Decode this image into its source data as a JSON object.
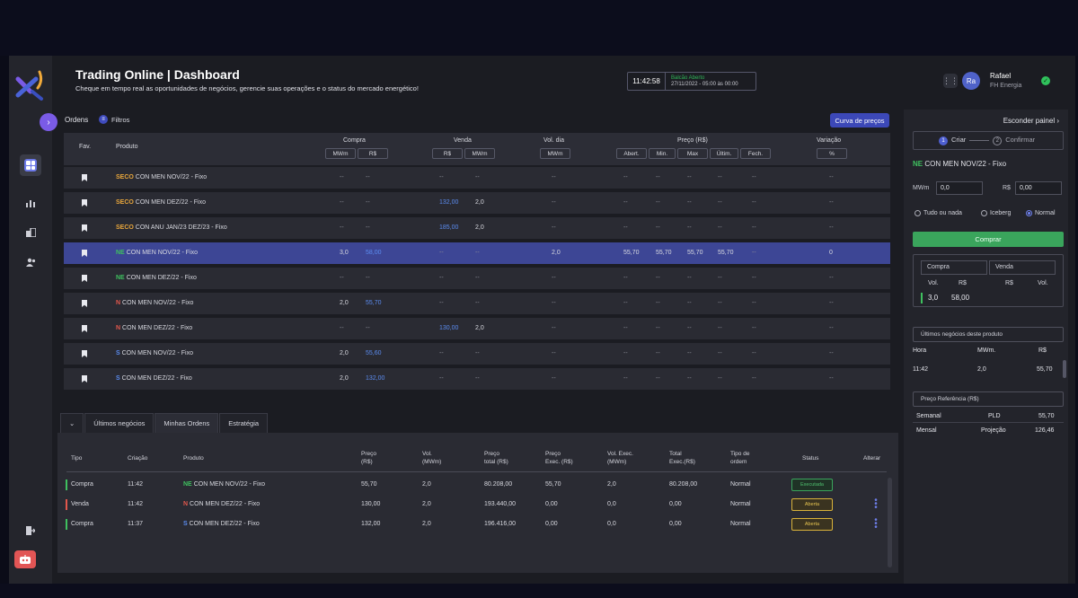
{
  "header": {
    "title": "Trading Online | Dashboard",
    "subtitle": "Cheque em tempo real as oportunidades de negócios, gerencie suas operações e o status do mercado energético!",
    "clock": "11:42:58",
    "session_label": "Balcão Aberto",
    "session_date": "27/11/2022 - 05:00 às 00:00",
    "user_initials": "Ra",
    "user_name": "Rafael",
    "user_company": "FH Energia",
    "status_color": "#30c25c"
  },
  "sidebar": {
    "icons": [
      "dashboard-icon",
      "bar-chart-icon",
      "building-icon",
      "users-icon"
    ],
    "logout_icon": "logout-icon",
    "assistant_icon": "bot-icon"
  },
  "orders": {
    "section_label": "Ordens",
    "filter_label": "Filtros",
    "curve_button": "Curva de preços",
    "headers": {
      "fav": "Fav.",
      "produto": "Produto",
      "compra": "Compra",
      "venda": "Venda",
      "vol_dia": "Vol. dia",
      "preco": "Preço (R$)",
      "variacao": "Variação",
      "compra_mwm": "MWm",
      "compra_rs": "R$",
      "venda_rs": "R$",
      "venda_mwm": "MWm",
      "vol_mwm": "MWm",
      "abert": "Abert.",
      "min": "Min.",
      "max": "Max",
      "ultim": "Últim.",
      "fech": "Fech.",
      "pct": "%"
    },
    "rows": [
      {
        "tag": "SECO",
        "tag_class": "tag-seco",
        "name": "CON MEN NOV/22 - Fixo",
        "c_mwm": "--",
        "c_rs": "--",
        "v_rs": "--",
        "v_mwm": "--",
        "vol": "--",
        "abert": "--",
        "min": "--",
        "max": "--",
        "ultim": "--",
        "fech": "--",
        "var": "--"
      },
      {
        "tag": "SECO",
        "tag_class": "tag-seco",
        "name": "CON MEN DEZ/22 - Fixo",
        "c_mwm": "--",
        "c_rs": "--",
        "v_rs": "132,00",
        "v_mwm": "2,0",
        "vol": "--",
        "abert": "--",
        "min": "--",
        "max": "--",
        "ultim": "--",
        "fech": "--",
        "var": "--"
      },
      {
        "tag": "SECO",
        "tag_class": "tag-seco",
        "name": "CON ANU JAN/23 DEZ/23 - Fixo",
        "c_mwm": "--",
        "c_rs": "--",
        "v_rs": "185,00",
        "v_mwm": "2,0",
        "vol": "--",
        "abert": "--",
        "min": "--",
        "max": "--",
        "ultim": "--",
        "fech": "--",
        "var": "--"
      },
      {
        "tag": "NE",
        "tag_class": "tag-ne",
        "name": "CON MEN NOV/22 - Fixo",
        "c_mwm": "3,0",
        "c_rs": "58,00",
        "v_rs": "--",
        "v_mwm": "--",
        "vol": "2,0",
        "abert": "55,70",
        "min": "55,70",
        "max": "55,70",
        "ultim": "55,70",
        "fech": "--",
        "var": "0",
        "selected": true
      },
      {
        "tag": "NE",
        "tag_class": "tag-ne",
        "name": "CON MEN DEZ/22 - Fixo",
        "c_mwm": "--",
        "c_rs": "--",
        "v_rs": "--",
        "v_mwm": "--",
        "vol": "--",
        "abert": "--",
        "min": "--",
        "max": "--",
        "ultim": "--",
        "fech": "--",
        "var": "--"
      },
      {
        "tag": "N",
        "tag_class": "tag-n",
        "name": "CON MEN NOV/22 - Fixo",
        "c_mwm": "2,0",
        "c_rs": "55,70",
        "v_rs": "--",
        "v_mwm": "--",
        "vol": "--",
        "abert": "--",
        "min": "--",
        "max": "--",
        "ultim": "--",
        "fech": "--",
        "var": "--"
      },
      {
        "tag": "N",
        "tag_class": "tag-n",
        "name": "CON MEN DEZ/22 - Fixo",
        "c_mwm": "--",
        "c_rs": "--",
        "v_rs": "130,00",
        "v_mwm": "2,0",
        "vol": "--",
        "abert": "--",
        "min": "--",
        "max": "--",
        "ultim": "--",
        "fech": "--",
        "var": "--"
      },
      {
        "tag": "S",
        "tag_class": "tag-s",
        "name": "CON MEN NOV/22 - Fixo",
        "c_mwm": "2,0",
        "c_rs": "55,60",
        "v_rs": "--",
        "v_mwm": "--",
        "vol": "--",
        "abert": "--",
        "min": "--",
        "max": "--",
        "ultim": "--",
        "fech": "--",
        "var": "--"
      },
      {
        "tag": "S",
        "tag_class": "tag-s",
        "name": "CON MEN DEZ/22 - Fixo",
        "c_mwm": "2,0",
        "c_rs": "132,00",
        "v_rs": "--",
        "v_mwm": "--",
        "vol": "--",
        "abert": "--",
        "min": "--",
        "max": "--",
        "ultim": "--",
        "fech": "--",
        "var": "--"
      }
    ]
  },
  "bottom": {
    "tabs": [
      "Últimos negócios",
      "Minhas Ordens",
      "Estratégia"
    ],
    "active_tab": 1,
    "headers": {
      "tipo": "Tipo",
      "criacao": "Criação",
      "produto": "Produto",
      "preco": "Preço\n(R$)",
      "vol": "Vol.\n(MWm)",
      "preco_total": "Preço\ntotal (R$)",
      "preco_exec": "Preço\nExec. (R$)",
      "vol_exec": "Vol. Exec.\n(MWm)",
      "total_exec": "Total\nExec.(R$)",
      "tipo_ordem": "Tipo de\nordem",
      "status": "Status",
      "alterar": "Alterar"
    },
    "rows": [
      {
        "tipo": "Compra",
        "bar": "#3fc05f",
        "criacao": "11:42",
        "tag": "NE",
        "tag_class": "tag-ne",
        "produto": "CON MEN NOV/22 - Fixo",
        "preco": "55,70",
        "vol": "2,0",
        "preco_total": "80.208,00",
        "preco_exec": "55,70",
        "vol_exec": "2,0",
        "total_exec": "80.208,00",
        "tipo_ordem": "Normal",
        "status": "Executada",
        "status_class": "st-exec",
        "editable": false
      },
      {
        "tipo": "Venda",
        "bar": "#e2574c",
        "criacao": "11:42",
        "tag": "N",
        "tag_class": "tag-n",
        "produto": "CON MEN DEZ/22 - Fixo",
        "preco": "130,00",
        "vol": "2,0",
        "preco_total": "193.440,00",
        "preco_exec": "0,00",
        "vol_exec": "0,0",
        "total_exec": "0,00",
        "tipo_ordem": "Normal",
        "status": "Aberta",
        "status_class": "st-open",
        "editable": true
      },
      {
        "tipo": "Compra",
        "bar": "#3fc05f",
        "criacao": "11:37",
        "tag": "S",
        "tag_class": "tag-s",
        "produto": "CON MEN DEZ/22 - Fixo",
        "preco": "132,00",
        "vol": "2,0",
        "preco_total": "196.416,00",
        "preco_exec": "0,00",
        "vol_exec": "0,0",
        "total_exec": "0,00",
        "tipo_ordem": "Normal",
        "status": "Aberta",
        "status_class": "st-open",
        "editable": true
      }
    ]
  },
  "right_panel": {
    "hide_label": "Esconder painel",
    "step1_num": "1",
    "step1_label": "Criar",
    "step2_num": "2",
    "step2_label": "Confirmar",
    "product_tag": "NE",
    "product_name": "CON MEN NOV/22 - Fixo",
    "mwm_label": "MWm",
    "mwm_value": "0,0",
    "rs_label": "R$",
    "rs_value": "0,00",
    "order_types": [
      "Tudo ou nada",
      "Iceberg",
      "Normal"
    ],
    "order_type_selected": 2,
    "buy_button": "Comprar",
    "book_buy": "Compra",
    "book_sell": "Venda",
    "book_h_vol": "Vol.",
    "book_h_rs": "R$",
    "book_h_rs2": "R$",
    "book_h_vol2": "Vol.",
    "book_vol": "3,0",
    "book_rs": "58,00",
    "last_trades_title": "Últimos negócios deste produto",
    "last_h_hora": "Hora",
    "last_h_mwm": "MWm.",
    "last_h_rs": "R$",
    "last_hora": "11:42",
    "last_mwm": "2,0",
    "last_rs": "55,70",
    "ref_title": "Preço Referência (R$)",
    "ref_semanal": "Semanal",
    "ref_pld": "PLD",
    "ref_pld_value": "55,70",
    "ref_mensal": "Mensal",
    "ref_proj": "Projeção",
    "ref_proj_value": "126,46"
  }
}
